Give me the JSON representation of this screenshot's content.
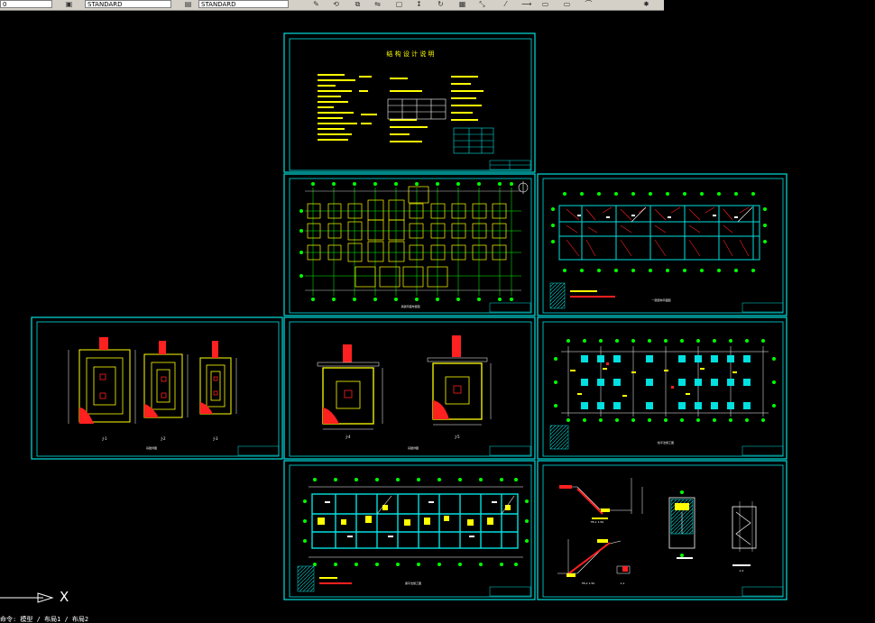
{
  "toolbar": {
    "layer_value": "0",
    "style_combo_1": "STANDARD",
    "style_combo_2": "STANDARD",
    "icons": [
      "layer-icon",
      "text-style-icon",
      "dim-style-icon",
      "pencil-icon",
      "match-prop-icon",
      "copy-icon",
      "mirror-icon",
      "offset-icon",
      "array-icon",
      "move-icon",
      "rotate-icon",
      "scale-icon",
      "stretch-icon",
      "trim-icon",
      "extend-icon",
      "break-icon",
      "chamfer-icon",
      "fillet-icon",
      "explode-icon"
    ]
  },
  "ucs": {
    "x_axis_label": "X"
  },
  "command_line": {
    "text": "命令: 模型 / 布局1 / 布局2"
  },
  "colors": {
    "background": "#000000",
    "frame": "#00e0e0",
    "title": "#ffff00",
    "grid": "#00ff00",
    "detail": "#ff2020",
    "white": "#ffffff"
  },
  "drawings": {
    "d1": {
      "title": "结 构 设 计 说 明"
    },
    "d2": {
      "title": "基础平面布置图"
    },
    "d3": {
      "title": "一层结构平面图"
    },
    "d4": {
      "title": "基础详图",
      "labels": [
        "J-1",
        "J-2",
        "J-3"
      ]
    },
    "d5": {
      "title": "基础详图",
      "labels": [
        "J-4",
        "J-5"
      ]
    },
    "d6": {
      "title": "柱平法施工图"
    },
    "d7": {
      "title": "梁平法施工图"
    },
    "d8": {
      "title": "楼梯详图",
      "labels": [
        "TB-1 1:50",
        "TB-2 1:50",
        "1-1",
        "2-2"
      ]
    }
  }
}
